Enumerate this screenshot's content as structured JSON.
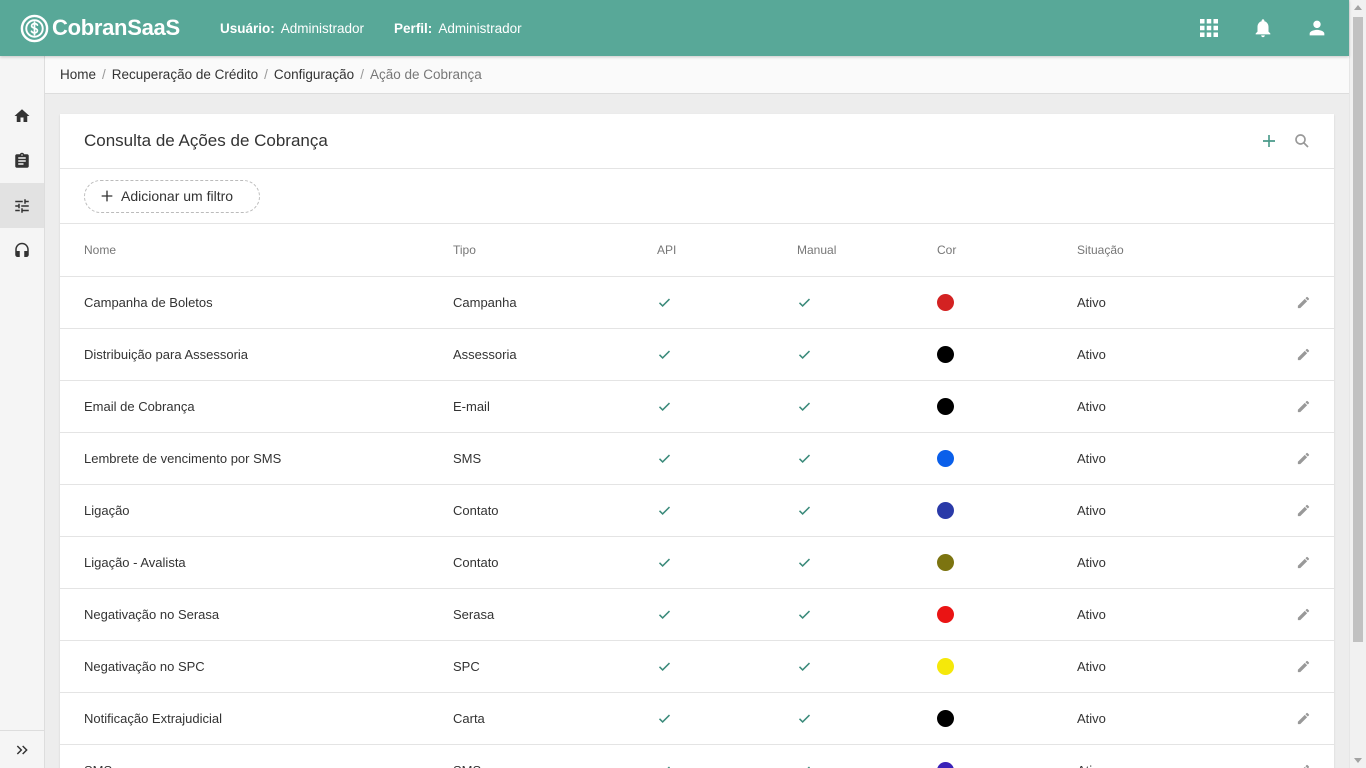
{
  "app": {
    "logo_text": "CobranSaaS"
  },
  "header": {
    "user_label": "Usuário:",
    "user_value": "Administrador",
    "profile_label": "Perfil:",
    "profile_value": "Administrador",
    "icons": [
      "apps-grid-icon",
      "bell-icon",
      "account-icon"
    ]
  },
  "sidebar": {
    "items": [
      "home-icon",
      "clipboard-icon",
      "tune-icon",
      "headset-icon"
    ],
    "active": "tune-icon",
    "expand_icon": "double-chevron-right-icon"
  },
  "breadcrumb": [
    "Home",
    "Recuperação de Crédito",
    "Configuração",
    "Ação de Cobrança"
  ],
  "page": {
    "title": "Consulta de Ações de Cobrança",
    "add_filter": "Adicionar um filtro"
  },
  "table": {
    "headers": {
      "nome": "Nome",
      "tipo": "Tipo",
      "api": "API",
      "manual": "Manual",
      "cor": "Cor",
      "situacao": "Situação"
    },
    "rows": [
      {
        "nome": "Campanha de Boletos",
        "tipo": "Campanha",
        "api": true,
        "manual": true,
        "cor": "#d32222",
        "situacao": "Ativo"
      },
      {
        "nome": "Distribuição para Assessoria",
        "tipo": "Assessoria",
        "api": true,
        "manual": true,
        "cor": "#000000",
        "situacao": "Ativo"
      },
      {
        "nome": "Email de Cobrança",
        "tipo": "E-mail",
        "api": true,
        "manual": true,
        "cor": "#000000",
        "situacao": "Ativo"
      },
      {
        "nome": "Lembrete de vencimento por SMS",
        "tipo": "SMS",
        "api": true,
        "manual": true,
        "cor": "#0a5fea",
        "situacao": "Ativo"
      },
      {
        "nome": "Ligação",
        "tipo": "Contato",
        "api": true,
        "manual": true,
        "cor": "#2a3aa8",
        "situacao": "Ativo"
      },
      {
        "nome": "Ligação - Avalista",
        "tipo": "Contato",
        "api": true,
        "manual": true,
        "cor": "#7c7410",
        "situacao": "Ativo"
      },
      {
        "nome": "Negativação no Serasa",
        "tipo": "Serasa",
        "api": true,
        "manual": true,
        "cor": "#ea1414",
        "situacao": "Ativo"
      },
      {
        "nome": "Negativação no SPC",
        "tipo": "SPC",
        "api": true,
        "manual": true,
        "cor": "#f5e80a",
        "situacao": "Ativo"
      },
      {
        "nome": "Notificação Extrajudicial",
        "tipo": "Carta",
        "api": true,
        "manual": true,
        "cor": "#000000",
        "situacao": "Ativo"
      },
      {
        "nome": "SMS",
        "tipo": "SMS",
        "api": true,
        "manual": true,
        "cor": "#3a22b8",
        "situacao": "Ativo"
      }
    ]
  },
  "colors": {
    "topbar": "#58a898",
    "accent": "#4a9a8a",
    "check": "#3a8a7a"
  }
}
